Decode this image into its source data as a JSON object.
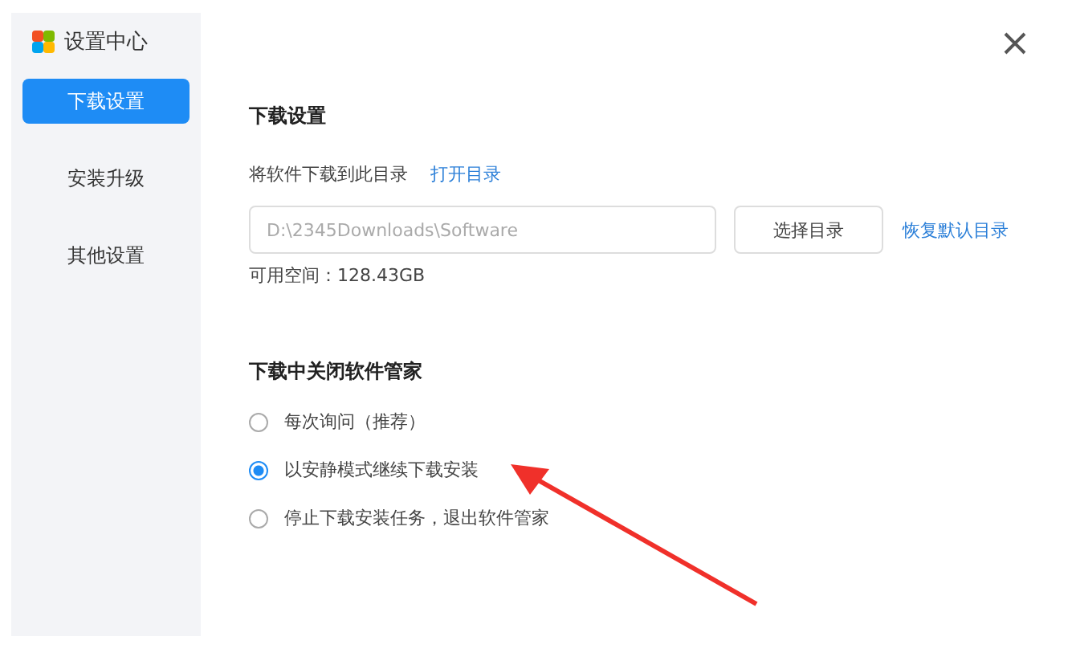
{
  "window": {
    "title": "设置中心"
  },
  "sidebar": {
    "items": [
      {
        "label": "下载设置",
        "selected": true
      },
      {
        "label": "安装升级",
        "selected": false
      },
      {
        "label": "其他设置",
        "selected": false
      }
    ]
  },
  "download": {
    "heading": "下载设置",
    "folder_label": "将软件下载到此目录",
    "open_link": "打开目录",
    "path": "D:\\2345Downloads\\Software",
    "choose_button": "选择目录",
    "reset_link": "恢复默认目录",
    "free_space": "可用空间：128.43GB"
  },
  "close_section": {
    "heading": "下载中关闭软件管家",
    "options": [
      {
        "label": "每次询问（推荐）",
        "selected": false
      },
      {
        "label": "以安静模式继续下载安装",
        "selected": true
      },
      {
        "label": "停止下载安装任务，退出软件管家",
        "selected": false
      }
    ]
  }
}
